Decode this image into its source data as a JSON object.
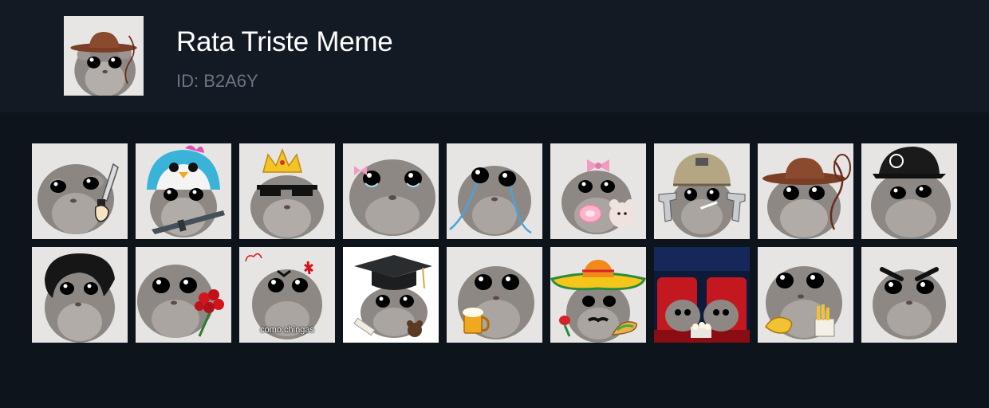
{
  "pack": {
    "title": "Rata Triste Meme",
    "id_label": "ID: B2A6Y"
  },
  "stickers": [
    {
      "name": "hamster-knife"
    },
    {
      "name": "hamster-penguin-hat-rifle"
    },
    {
      "name": "hamster-crown-sunglasses"
    },
    {
      "name": "hamster-pink-bow-teary"
    },
    {
      "name": "hamster-crying-tears"
    },
    {
      "name": "hamster-bow-pacifier-teddy"
    },
    {
      "name": "hamster-helmet-pistols"
    },
    {
      "name": "hamster-cowboy-hat-lasso"
    },
    {
      "name": "hamster-black-cap"
    },
    {
      "name": "hamster-black-hair"
    },
    {
      "name": "hamster-roses"
    },
    {
      "name": "hamster-angry-caption",
      "caption": "como chingas"
    },
    {
      "name": "hamster-graduation-cap"
    },
    {
      "name": "hamster-beer"
    },
    {
      "name": "hamster-sombrero-taco"
    },
    {
      "name": "hamsters-cinema-popcorn"
    },
    {
      "name": "hamster-fries"
    },
    {
      "name": "hamster-angry-eyebrows"
    }
  ]
}
